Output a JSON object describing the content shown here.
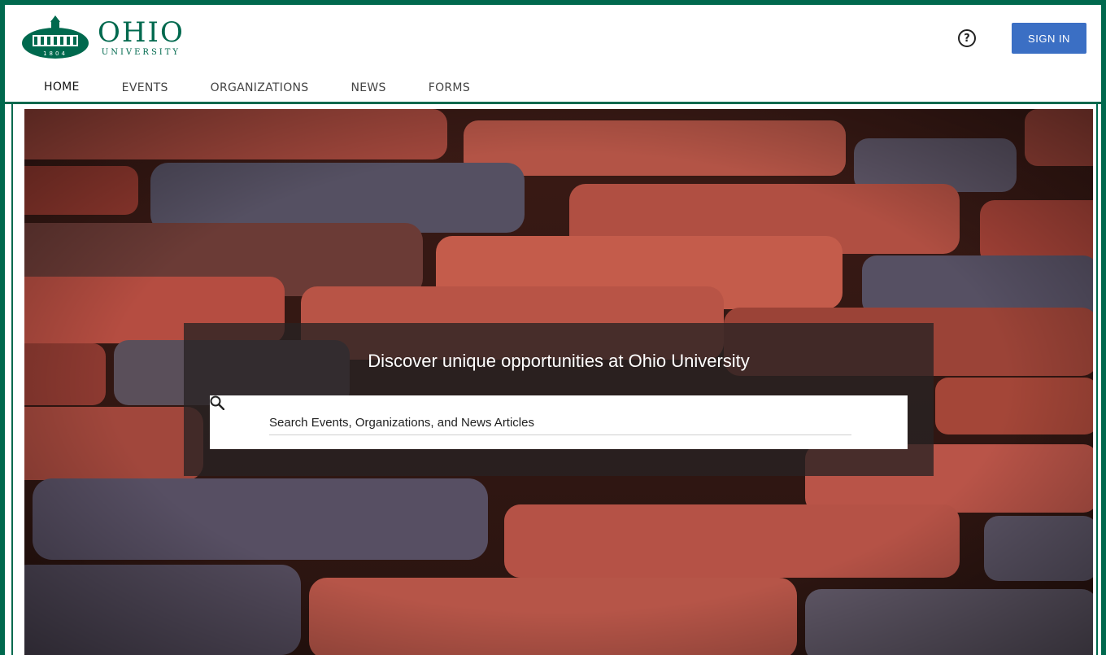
{
  "brand": {
    "name": "OHIO",
    "subtitle": "UNIVERSITY",
    "year": "1804",
    "color": "#00694e"
  },
  "header": {
    "help_icon": "help-circle-icon",
    "help_glyph": "?",
    "signin_label": "SIGN IN",
    "signin_color": "#3b6fc4"
  },
  "nav": {
    "items": [
      {
        "label": "HOME",
        "active": true
      },
      {
        "label": "EVENTS",
        "active": false
      },
      {
        "label": "ORGANIZATIONS",
        "active": false
      },
      {
        "label": "NEWS",
        "active": false
      },
      {
        "label": "FORMS",
        "active": false
      }
    ]
  },
  "hero": {
    "headline": "Discover unique opportunities at Ohio University",
    "search_placeholder": "Search Events, Organizations, and News Articles",
    "search_value": "",
    "search_icon": "search-icon"
  }
}
